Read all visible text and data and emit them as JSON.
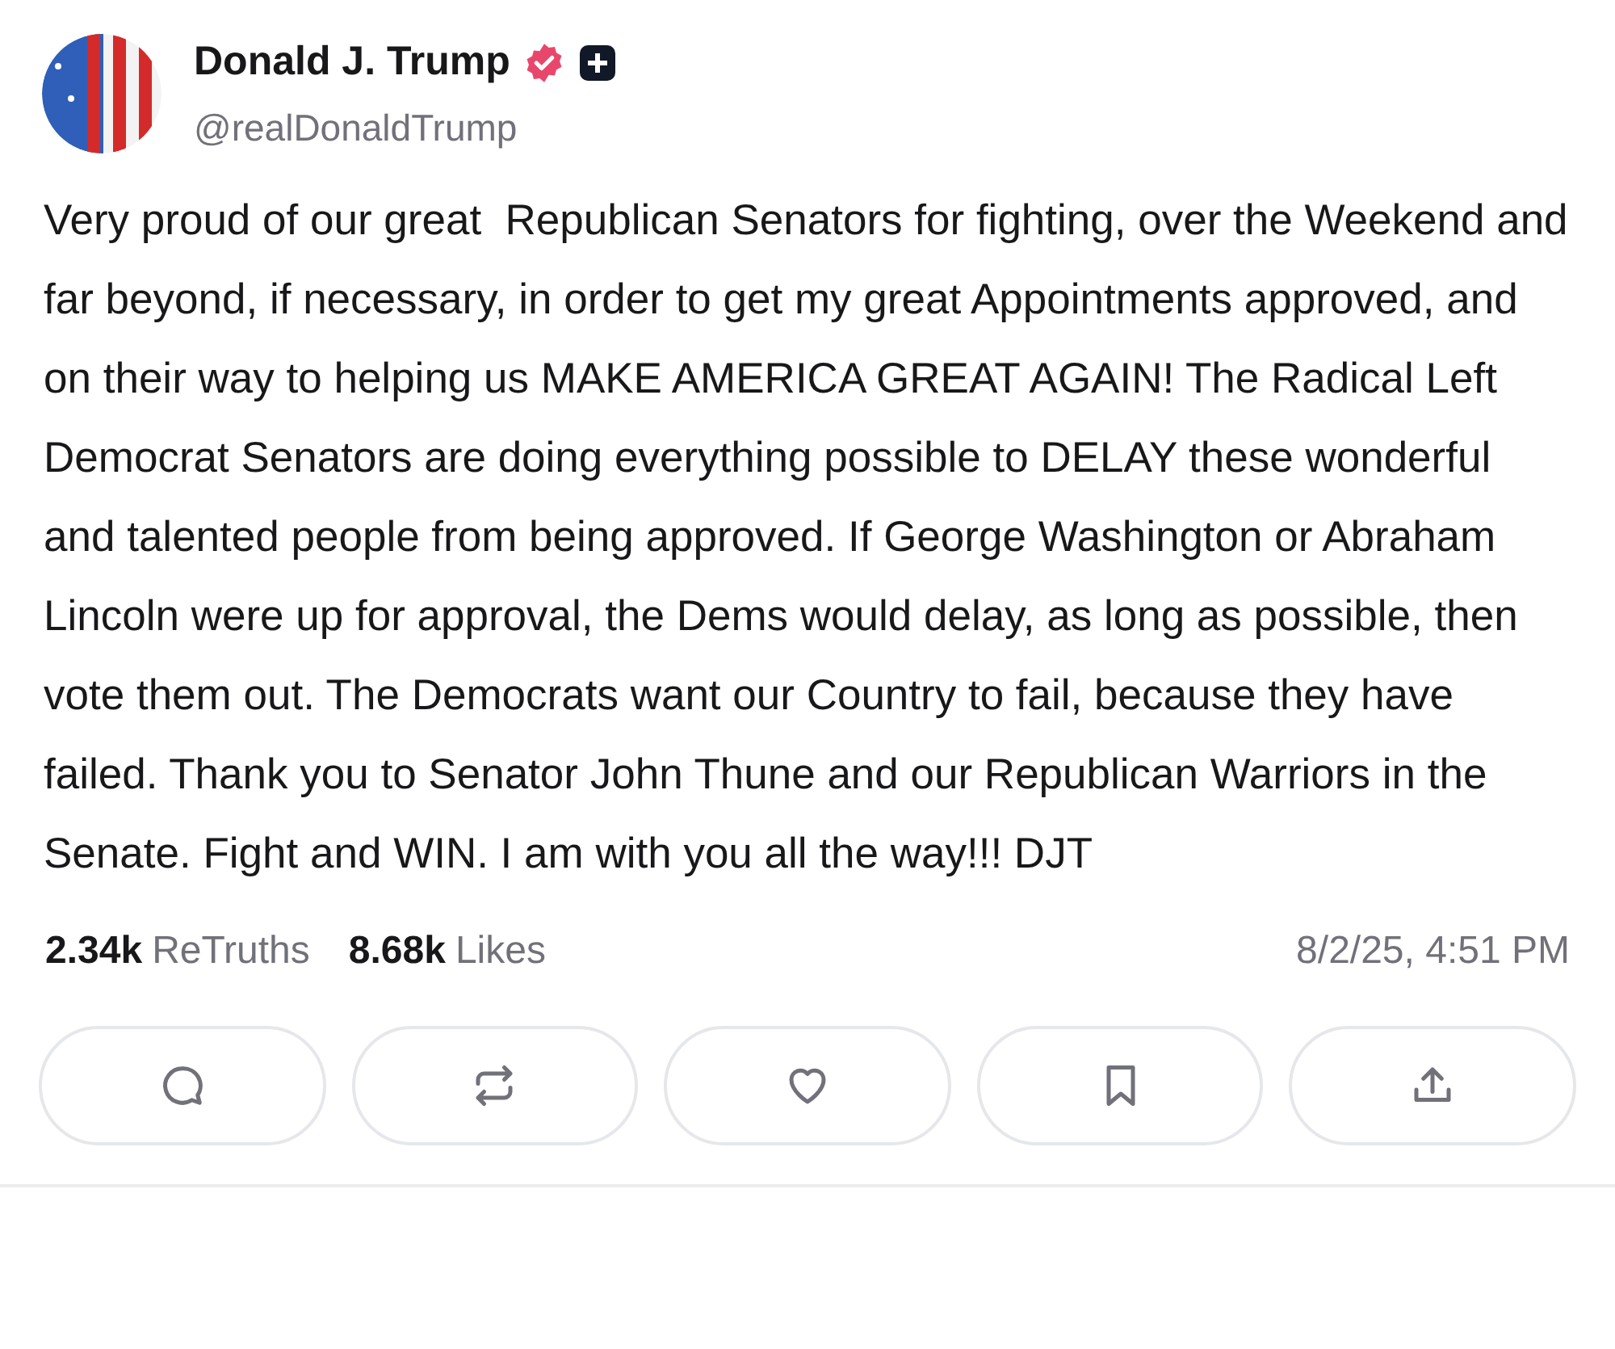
{
  "author": {
    "name": "Donald J. Trump",
    "verified": true,
    "handle": "@realDonaldTrump"
  },
  "body": "Very proud of our great  Republican Senators for fighting, over the Weekend and far beyond, if necessary, in order to get my great Appointments approved, and on their way to helping us MAKE AMERICA GREAT AGAIN! The Radical Left Democrat Senators are doing everything possible to DELAY these wonderful and talented people from being approved. If George Washington or Abraham Lincoln were up for approval, the Dems would delay, as long as possible, then vote them out. The Democrats want our Country to fail, because they have failed. Thank you to Senator John Thune and our Republican Warriors in the Senate. Fight and WIN. I am with you all the way!!! DJT",
  "stats": [
    {
      "count": "2.34k",
      "label": "ReTruths"
    },
    {
      "count": "8.68k",
      "label": "Likes"
    }
  ],
  "timestamp": "8/2/25, 4:51 PM",
  "actions": [
    {
      "kind": "reply"
    },
    {
      "kind": "repost"
    },
    {
      "kind": "like"
    },
    {
      "kind": "bookmark"
    },
    {
      "kind": "share"
    }
  ]
}
